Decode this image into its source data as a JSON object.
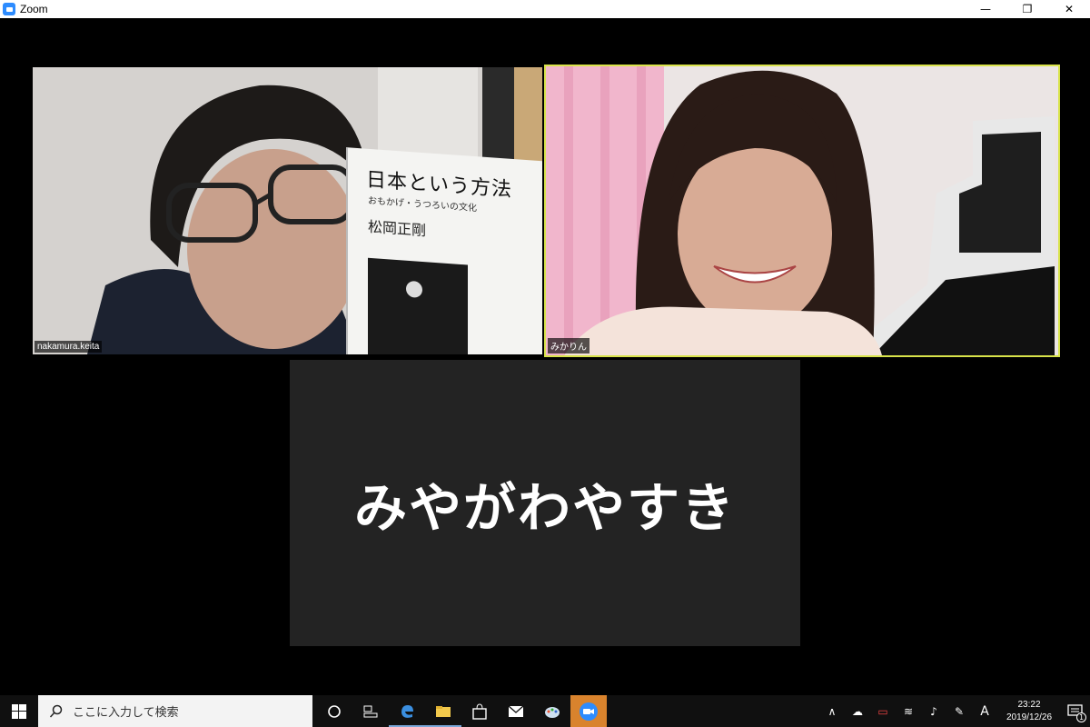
{
  "window": {
    "title": "Zoom",
    "controls": [
      "—",
      "❐",
      "✕"
    ]
  },
  "participants": [
    {
      "name": "nakamura.keita",
      "book": {
        "title": "日本という方法",
        "subtitle": "おもかげ・うつろいの文化",
        "author": "松岡正剛"
      }
    },
    {
      "name": "みかりん",
      "active_speaker": true
    }
  ],
  "name_only_tile": {
    "display_name": "みやがわやすき"
  },
  "taskbar": {
    "search_placeholder": "ここに入力して検索",
    "apps": [
      "cortana-icon",
      "task-view-icon",
      "edge-icon",
      "file-explorer-icon",
      "store-icon",
      "mail-icon",
      "paint-icon",
      "zoom-icon"
    ],
    "tray": {
      "ime": "A",
      "time": "23:22",
      "date": "2019/12/26",
      "notification_count": "1"
    }
  },
  "colors": {
    "active_outline": "#d8e34a",
    "zoom_blue": "#2d8cff",
    "taskbar_active": "#d9832d"
  }
}
